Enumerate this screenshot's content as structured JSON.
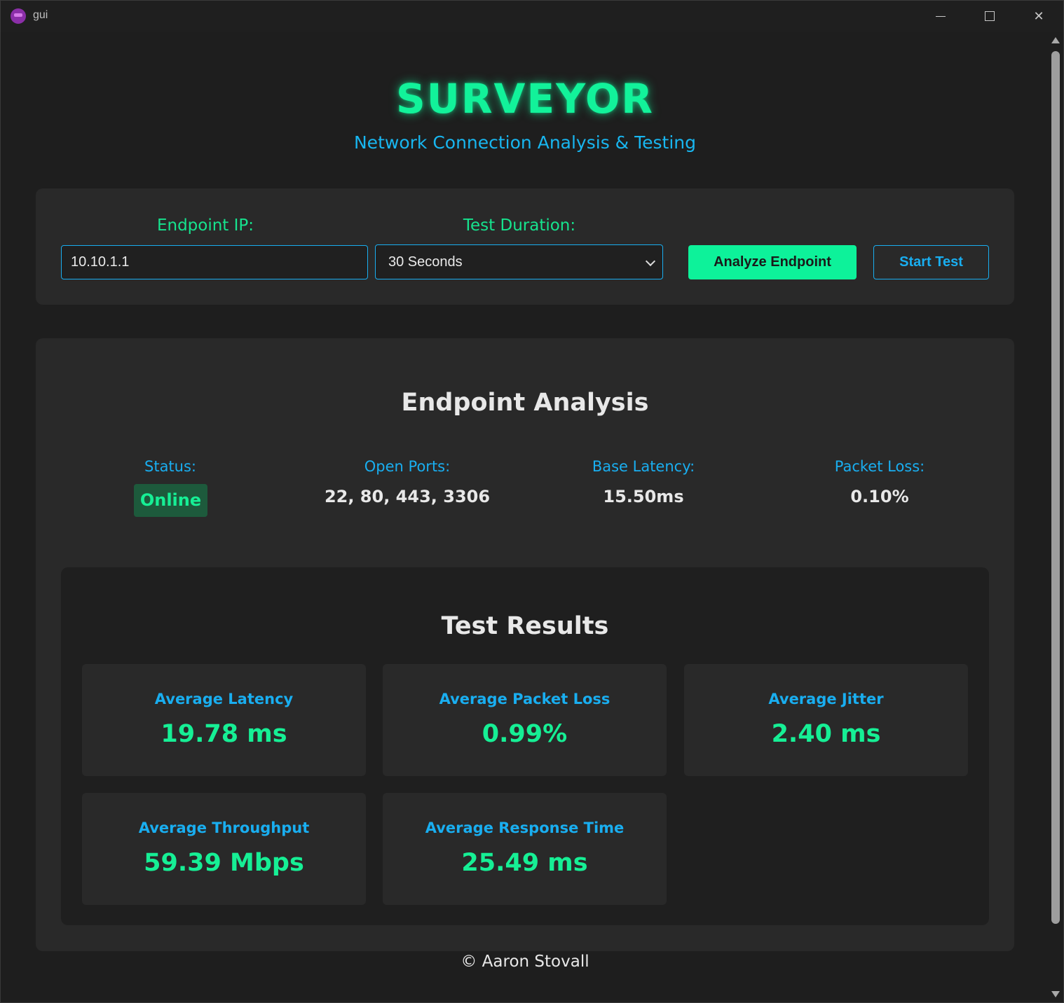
{
  "window": {
    "title": "gui",
    "icon": "app-icon",
    "controls": [
      "minimize-icon",
      "maximize-icon",
      "close-icon"
    ]
  },
  "header": {
    "title": "SURVEYOR",
    "subtitle": "Network Connection Analysis & Testing"
  },
  "controls": {
    "endpoint_label": "Endpoint IP:",
    "endpoint_value": "10.10.1.1",
    "duration_label": "Test Duration:",
    "duration_selected": "30 Seconds",
    "analyze_button": "Analyze Endpoint",
    "start_button": "Start Test"
  },
  "analysis": {
    "title": "Endpoint Analysis",
    "status_label": "Status:",
    "status_value": "Online",
    "ports_label": "Open Ports:",
    "ports_value": "22, 80, 443, 3306",
    "latency_label": "Base Latency:",
    "latency_value": "15.50ms",
    "loss_label": "Packet Loss:",
    "loss_value": "0.10%"
  },
  "results": {
    "title": "Test Results",
    "cards": [
      {
        "label": "Average Latency",
        "value": "19.78 ms"
      },
      {
        "label": "Average Packet Loss",
        "value": "0.99%"
      },
      {
        "label": "Average Jitter",
        "value": "2.40 ms"
      },
      {
        "label": "Average Throughput",
        "value": "59.39 Mbps"
      },
      {
        "label": "Average Response Time",
        "value": "25.49 ms"
      }
    ]
  },
  "footer": {
    "copyright": "© Aaron Stovall"
  },
  "colors": {
    "accent_green": "#12f29a",
    "accent_blue": "#19aef0",
    "background": "#1e1e1e",
    "panel": "#292929"
  }
}
